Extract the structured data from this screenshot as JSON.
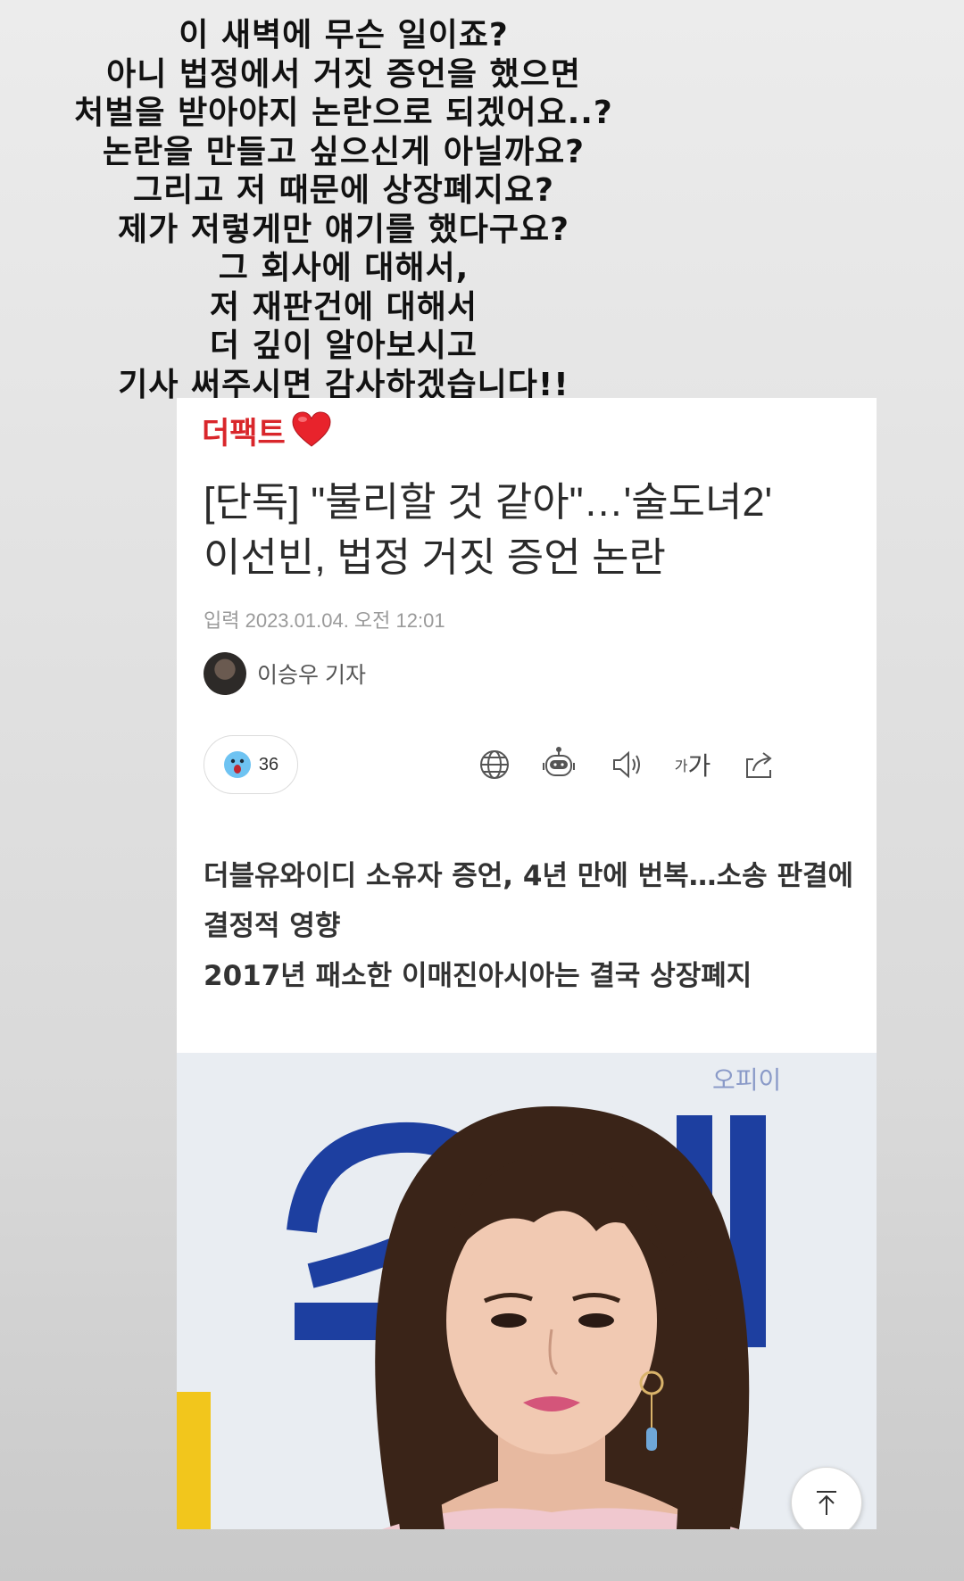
{
  "story_text": {
    "lines": [
      "이 새벽에 무슨 일이죠?",
      "아니 법정에서 거짓 증언을 했으면",
      "처벌을 받아야지 논란으로 되겠어요..?",
      "논란을 만들고 싶으신게 아닐까요?",
      "그리고 저 때문에 상장폐지요?",
      "제가 저렇게만 얘기를 했다구요?",
      "그 회사에 대해서,",
      "저 재판건에 대해서",
      "더 깊이 알아보시고",
      "기사 써주시면 감사하겠습니다!!"
    ]
  },
  "article": {
    "brand": "더팩트",
    "brand_color": "#d9262b",
    "heart_icon": "red-heart",
    "headline_lines": [
      "[단독] \"불리할 것 같아\"…'술도녀2'",
      "이선빈, 법정 거짓 증언 논란"
    ],
    "date": "입력 2023.01.04. 오전 12:01",
    "reporter": "이승우 기자",
    "reaction": {
      "icon": "surprised-face",
      "count": "36"
    },
    "toolbar": {
      "icons": [
        "globe-icon",
        "robot-icon",
        "speaker-icon",
        "font-size-icon",
        "share-icon"
      ],
      "font_small": "가",
      "font_big": "가"
    },
    "summary_lines": [
      "더블유와이디 소유자 증언, 4년 만에 번복…소송 판결에 결정적 영향",
      "2017년 패소한 이매진아시아는 결국 상장폐지"
    ],
    "photo": {
      "backdrop_text": "오피이"
    }
  }
}
